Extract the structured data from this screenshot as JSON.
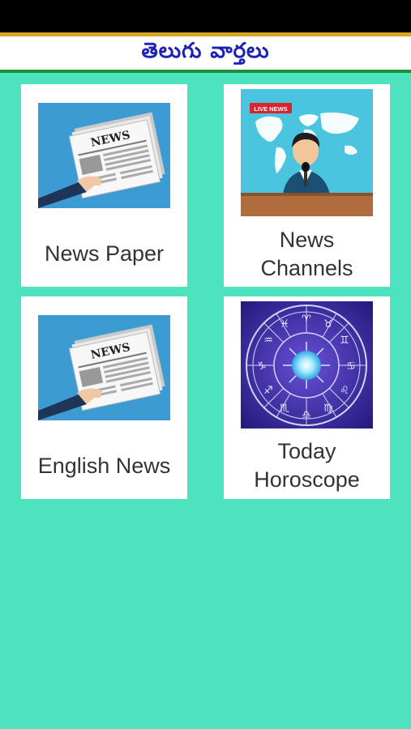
{
  "header": {
    "title": "తెలుగు వార్తలు"
  },
  "cards": [
    {
      "label": "News Paper",
      "icon": "newspaper-hand-icon"
    },
    {
      "label_line1": "News",
      "label_line2": "Channels",
      "icon": "news-anchor-icon",
      "badge": "LIVE NEWS"
    },
    {
      "label": "English News",
      "icon": "newspaper-hand-icon"
    },
    {
      "label_line1": "Today",
      "label_line2": "Horoscope",
      "icon": "zodiac-wheel-icon"
    }
  ],
  "newspaper_masthead": "NEWS",
  "colors": {
    "background": "#4de3bf",
    "header_text": "#1c22b8",
    "header_top_border": "#d8a423",
    "header_bottom_border": "#1f8f3a"
  }
}
